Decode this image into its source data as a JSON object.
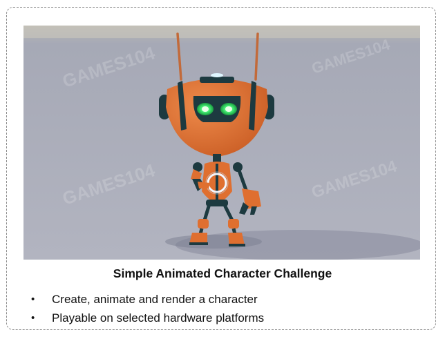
{
  "slide": {
    "caption_title": "Simple Animated Character Challenge",
    "bullets": [
      "Create, animate and render a character",
      "Playable on selected hardware platforms"
    ],
    "image": {
      "subject": "orange-robot-character",
      "watermark_text": "GAMES104"
    }
  },
  "colors": {
    "background_wall": "#a9acb9",
    "floor": "#b4b6c2",
    "robot_orange": "#df6f30",
    "robot_dark": "#1d3a40",
    "eye_green": "#36e36a"
  }
}
